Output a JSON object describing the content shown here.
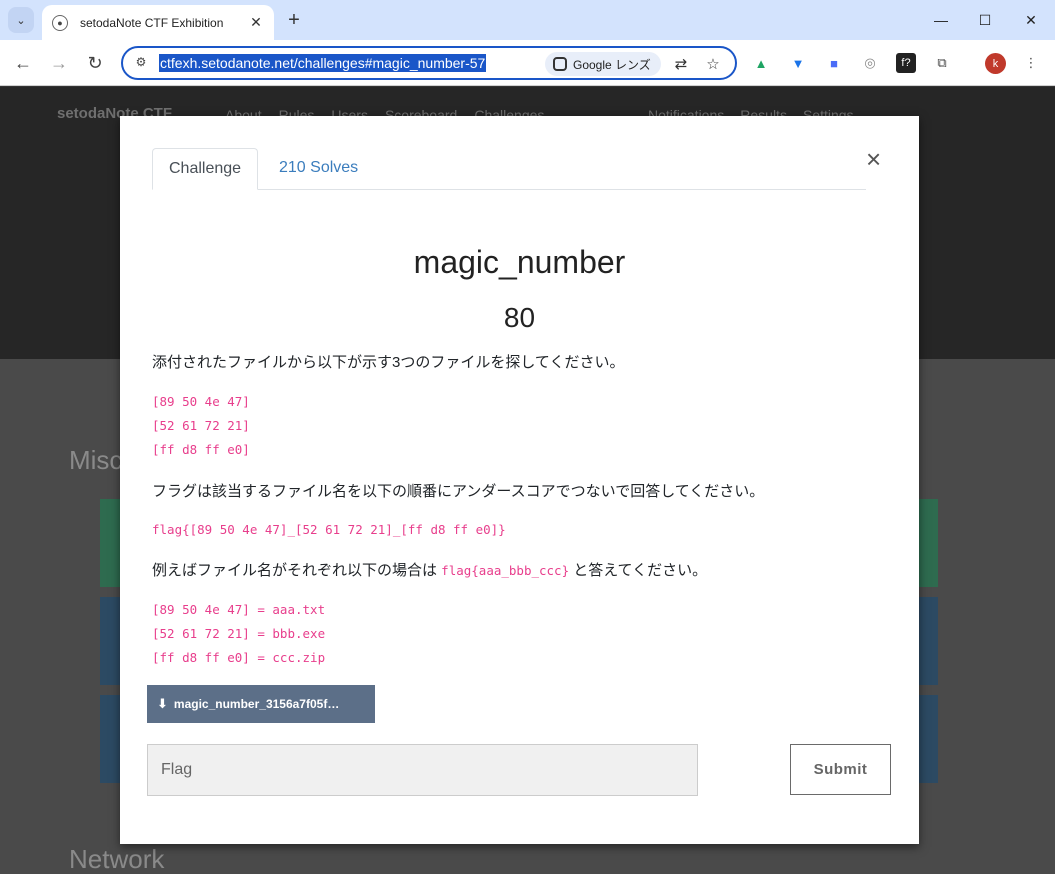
{
  "browser": {
    "tab_title": "setodaNote CTF Exhibition",
    "url": "ctfexh.setodanote.net/challenges#magic_number-57",
    "lens_label": "Google レンズ",
    "profile_initial": "k"
  },
  "background_page": {
    "brand": "setodaNote CTF",
    "nav_links": [
      "About",
      "Rules",
      "Users",
      "Scoreboard",
      "Challenges"
    ],
    "nav_right": [
      "Notifications",
      "Results",
      "Settings"
    ],
    "categories": [
      "Misc",
      "Network"
    ]
  },
  "modal": {
    "tabs": [
      "Challenge",
      "210 Solves"
    ],
    "close": "×",
    "name": "magic_number",
    "points": "80",
    "desc1": "添付されたファイルから以下が示す3つのファイルを探してください。",
    "codes1": [
      "[89 50 4e 47]",
      "[52 61 72 21]",
      "[ff d8 ff e0]"
    ],
    "desc2": "フラグは該当するファイル名を以下の順番にアンダースコアでつないで回答してください。",
    "code_flag": "flag{[89 50 4e 47]_[52 61 72 21]_[ff d8 ff e0]}",
    "desc3_pre": "例えばファイル名がそれぞれ以下の場合は ",
    "desc3_code": "flag{aaa_bbb_ccc}",
    "desc3_post": " と答えてください。",
    "codes2": [
      "[89 50 4e 47] = aaa.txt",
      "[52 61 72 21] = bbb.exe",
      "[ff d8 ff e0] = ccc.zip"
    ],
    "download_label": "magic_number_3156a7f05f…",
    "flag_placeholder": "Flag",
    "submit_label": "Submit"
  }
}
